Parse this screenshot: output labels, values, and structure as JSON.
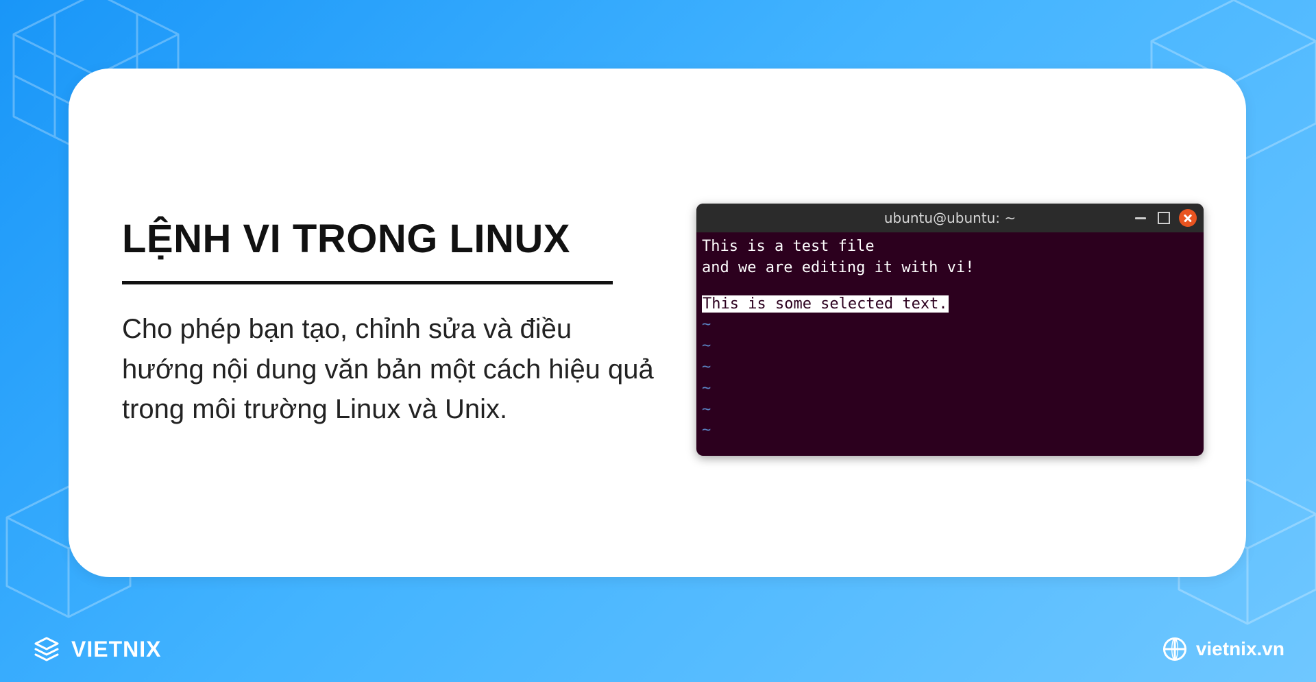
{
  "card": {
    "title": "LỆNH VI TRONG LINUX",
    "description": "Cho phép bạn tạo, chỉnh sửa và điều hướng nội dung văn bản một cách hiệu quả trong môi trường Linux và Unix."
  },
  "terminal": {
    "title": "ubuntu@ubuntu: ~",
    "lines": [
      "This is a test file",
      "and we are editing it with vi!"
    ],
    "selected_line": "This is some selected text.",
    "tilde_count": 6
  },
  "footer": {
    "brand": "VIETNIX",
    "url": "vietnix.vn"
  }
}
